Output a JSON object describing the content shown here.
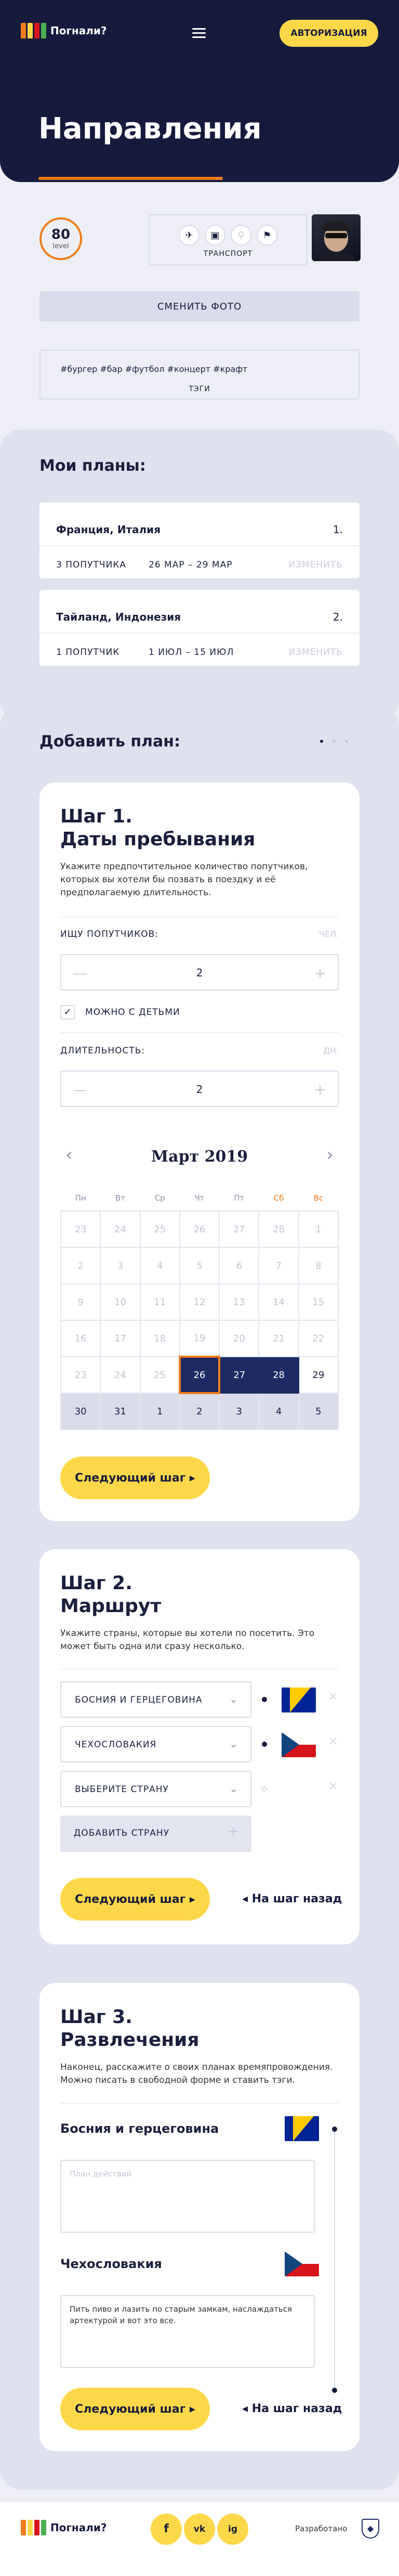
{
  "header": {
    "logo_text": "Погнали?",
    "auth_label": "АВТОРИЗАЦИЯ",
    "page_title": "Направления"
  },
  "profile": {
    "level_value": "80",
    "level_label": "level",
    "transport_label": "ТРАНСПОРТ",
    "transport_icons": [
      "plane-icon",
      "bus-icon",
      "bicycle-icon",
      "walking-icon"
    ],
    "change_photo_label": "СМЕНИТЬ ФОТО",
    "tags_text": "#бургер #бар #футбол #концерт #крафт",
    "tags_label": "ТЭГИ"
  },
  "my_plans": {
    "title": "Мои планы:",
    "plans": [
      {
        "name": "Франция, Италия",
        "index": "1.",
        "companions": "3 ПОПУТЧИКА",
        "dates": "26 МАР – 29 МАР",
        "edit": "ИЗМЕНИТЬ"
      },
      {
        "name": "Тайланд, Индонезия",
        "index": "2.",
        "companions": "1 ПОПУТЧИК",
        "dates": "1 ИЮЛ – 15 ИЮЛ",
        "edit": "ИЗМЕНИТЬ"
      }
    ]
  },
  "add_plan": {
    "title": "Добавить план:",
    "step1": {
      "title_line1": "Шаг 1.",
      "title_line2": "Даты пребывания",
      "description": "Укажите предпочтительное количество попутчиков, которых вы хотели бы позвать в поездку и её предполагаемую длительность.",
      "companions_label": "ИЩУ ПОПУТЧИКОВ:",
      "companions_unit": "ЧЕЛ.",
      "companions_value": "2",
      "kids_label": "МОЖНО С ДЕТЬМИ",
      "kids_checked": "✓",
      "duration_label": "ДЛИТЕЛЬНОСТЬ:",
      "duration_unit": "ДН.",
      "duration_value": "2",
      "calendar": {
        "month": "Март 2019",
        "weekdays": [
          "Пн",
          "Вт",
          "Ср",
          "Чт",
          "Пт",
          "Сб",
          "Вс"
        ],
        "rows": [
          [
            "23",
            "24",
            "25",
            "26",
            "27",
            "28",
            "1"
          ],
          [
            "2",
            "3",
            "4",
            "5",
            "6",
            "7",
            "8"
          ],
          [
            "9",
            "10",
            "11",
            "12",
            "13",
            "14",
            "15"
          ],
          [
            "16",
            "17",
            "18",
            "19",
            "20",
            "21",
            "22"
          ],
          [
            "23",
            "24",
            "25",
            "26",
            "27",
            "28",
            "29"
          ],
          [
            "30",
            "31",
            "1",
            "2",
            "3",
            "4",
            "5"
          ]
        ]
      },
      "next_label": "Следующий шаг"
    },
    "step2": {
      "title_line1": "Шаг 2.",
      "title_line2": "Маршрут",
      "description": "Укажите страны, которые вы хотели по посетить. Это может быть одна или сразу несколько.",
      "countries": [
        "БОСНИЯ И ГЕРЦЕГОВИНА",
        "ЧЕХОСЛОВАКИЯ",
        "ВЫБЕРИТЕ СТРАНУ"
      ],
      "add_country_label": "ДОБАВИТЬ СТРАНУ",
      "next_label": "Следующий шаг",
      "back_label": "На шаг назад"
    },
    "step3": {
      "title_line1": "Шаг 3.",
      "title_line2": "Развлечения",
      "description": "Наконец, расскажите о своих планах времяпровождения. Можно писать в свободной форме и ставить тэги.",
      "entries": [
        {
          "country": "Босния и герцеговина",
          "text": "План действий"
        },
        {
          "country": "Чехословакия",
          "text": "Пить пиво и лазить по старым замкам, наслаждаться артектурой и вот это все."
        }
      ],
      "next_label": "Следующий шаг",
      "back_label": "На шаг назад"
    }
  },
  "footer": {
    "logo_text": "Погнали?",
    "socials": [
      "f",
      "vk",
      "ig"
    ],
    "developed_by": "Разработано"
  },
  "colors": {
    "navy": "#161b3d",
    "accent_yellow": "#ffd84a",
    "accent_orange": "#f07d1a",
    "selected_day": "#1d2a63"
  }
}
